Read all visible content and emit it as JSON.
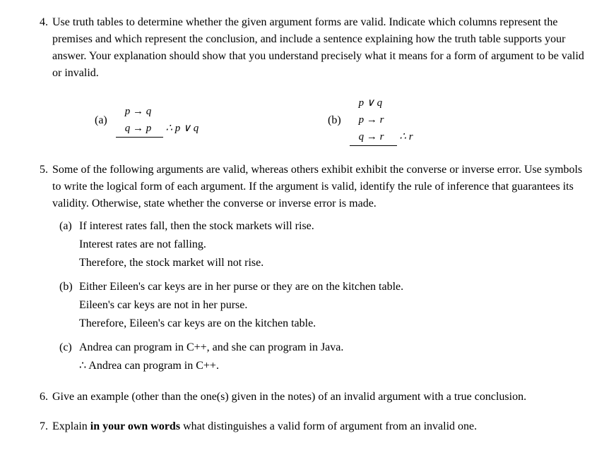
{
  "q4": {
    "num": "4.",
    "text": "Use truth tables to determine whether the given argument forms are valid. Indicate which columns represent the premises and which represent the conclusion, and include a sentence explaining how the truth table supports your answer. Your explanation should show that you understand precisely what it means for a form of argument to be valid or invalid.",
    "a": {
      "label": "(a)",
      "l1": "p → q",
      "l2": "q → p",
      "l3": "∴ p ∨ q"
    },
    "b": {
      "label": "(b)",
      "l1": "p ∨ q",
      "l2": "p → r",
      "l3": "q → r",
      "l4": "∴ r"
    }
  },
  "q5": {
    "num": "5.",
    "text": "Some of the following arguments are valid, whereas others exhibit exhibit the converse or inverse error. Use symbols to write the logical form of each argument. If the argument is valid, identify the rule of inference that guarantees its validity. Otherwise, state whether the converse or inverse error is made.",
    "a": {
      "label": "(a)",
      "l1": "If interest rates fall, then the stock markets will rise.",
      "l2": "Interest rates are not falling.",
      "l3": "Therefore, the stock market will not rise."
    },
    "b": {
      "label": "(b)",
      "l1": "Either Eileen's car keys are in her purse or they are on the kitchen table.",
      "l2": "Eileen's car keys are not in her purse.",
      "l3": "Therefore, Eileen's car keys are on the kitchen table."
    },
    "c": {
      "label": "(c)",
      "l1": "Andrea can program in C++, and she can program in Java.",
      "l2": "∴ Andrea can program in C++."
    }
  },
  "q6": {
    "num": "6.",
    "text": "Give an example (other than the one(s) given in the notes) of an invalid argument with a true conclusion."
  },
  "q7": {
    "num": "7.",
    "pre": "Explain ",
    "bold": "in your own words",
    "post": " what distinguishes a valid form of argument from an invalid one."
  }
}
